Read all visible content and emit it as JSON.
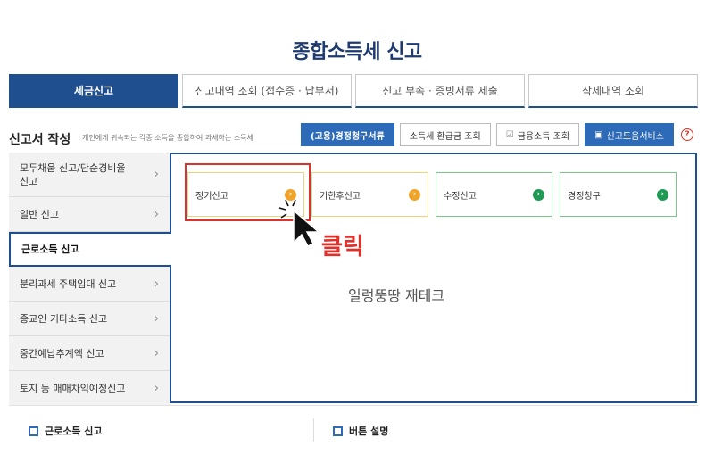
{
  "page_title": "종합소득세 신고",
  "tabs": [
    {
      "label": "세금신고"
    },
    {
      "label": "신고내역 조회 (접수증 · 납부서)"
    },
    {
      "label": "신고 부속 · 증빙서류 제출"
    },
    {
      "label": "삭제내역 조회"
    }
  ],
  "section": {
    "heading": "신고서 작성",
    "description": "개인에게 귀속되는 각종 소득을 종합하여 과세하는 소득세"
  },
  "toolbar": {
    "btn_correction": "(고용)경정청구서류",
    "btn_refund": "소득세 환급금 조회",
    "btn_finance": "금융소득 조회",
    "btn_service": "신고도움서비스",
    "help": "?"
  },
  "sidebar": {
    "items": [
      {
        "label": "모두채움 신고/단순경비율 신고"
      },
      {
        "label": "일반 신고"
      },
      {
        "label": "근로소득 신고"
      },
      {
        "label": "분리과세 주택임대 신고"
      },
      {
        "label": "종교인 기타소득 신고"
      },
      {
        "label": "중간예납추계액 신고"
      },
      {
        "label": "토지 등 매매차익예정신고"
      }
    ]
  },
  "cards": [
    {
      "label": "정기신고"
    },
    {
      "label": "기한후신고"
    },
    {
      "label": "수정신고"
    },
    {
      "label": "경정청구"
    }
  ],
  "annotation": {
    "click_label": "클릭",
    "watermark": "일렁뚱땅 재테크"
  },
  "bottom": {
    "left_label": "근로소득 신고",
    "right_label": "버튼 설명"
  },
  "colors": {
    "brand_navy": "#1f4f8f",
    "highlight_red": "#d9342b",
    "card_orange": "#f0a52a",
    "card_green": "#1f9a55"
  }
}
